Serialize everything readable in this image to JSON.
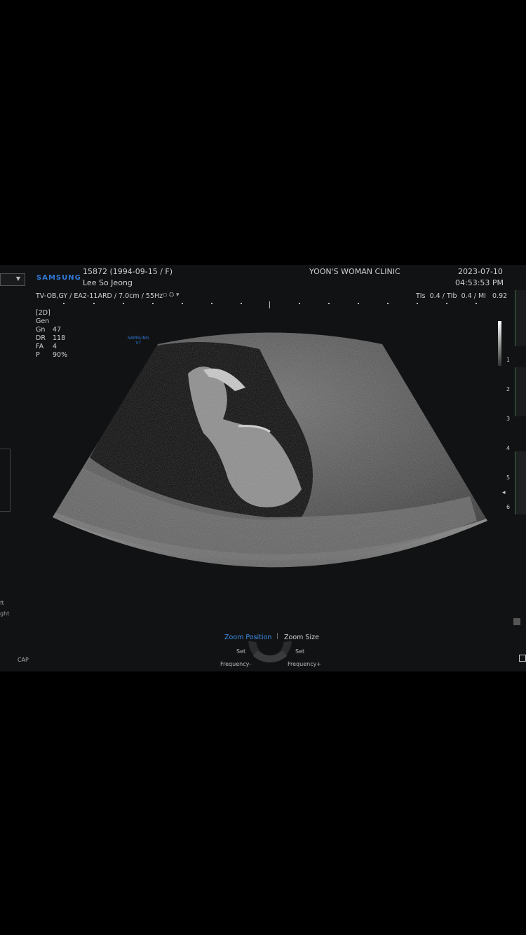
{
  "brand": "SAMSUNG",
  "patient": {
    "id_line": "15872 (1994-09-15 / F)",
    "name": "Lee So Jeong"
  },
  "clinic": "YOON'S WOMAN CLINIC",
  "date": "2023-07-10",
  "time": "04:53:53 PM",
  "probe_line": "TV-OB,GY / EA2-11ARD / 7.0cm / 55Hz",
  "indices": "TIs  0.4 / TIb  0.4 / MI   0.92",
  "params": {
    "mode": "[2D]",
    "gen": "Gen",
    "gn_label": "Gn",
    "gn_value": "47",
    "dr_label": "DR",
    "dr_value": "118",
    "fa_label": "FA",
    "fa_value": "4",
    "p_label": "P",
    "p_value": "90%"
  },
  "watermark": "SAMSUNG\nV7",
  "depth_scale": [
    "1",
    "2",
    "3",
    "4",
    "5",
    "6"
  ],
  "controls": {
    "zoom_position": "Zoom Position",
    "zoom_size": "Zoom Size",
    "set_left": "Set",
    "set_right": "Set",
    "freq_minus": "Frequency-",
    "freq_plus": "Frequency+"
  },
  "left_partial": {
    "line1": "ft",
    "line2": "ght"
  },
  "cap": "CAP",
  "colors": {
    "accent": "#3d8ee6",
    "brand": "#2f79d6",
    "background": "#111213"
  }
}
